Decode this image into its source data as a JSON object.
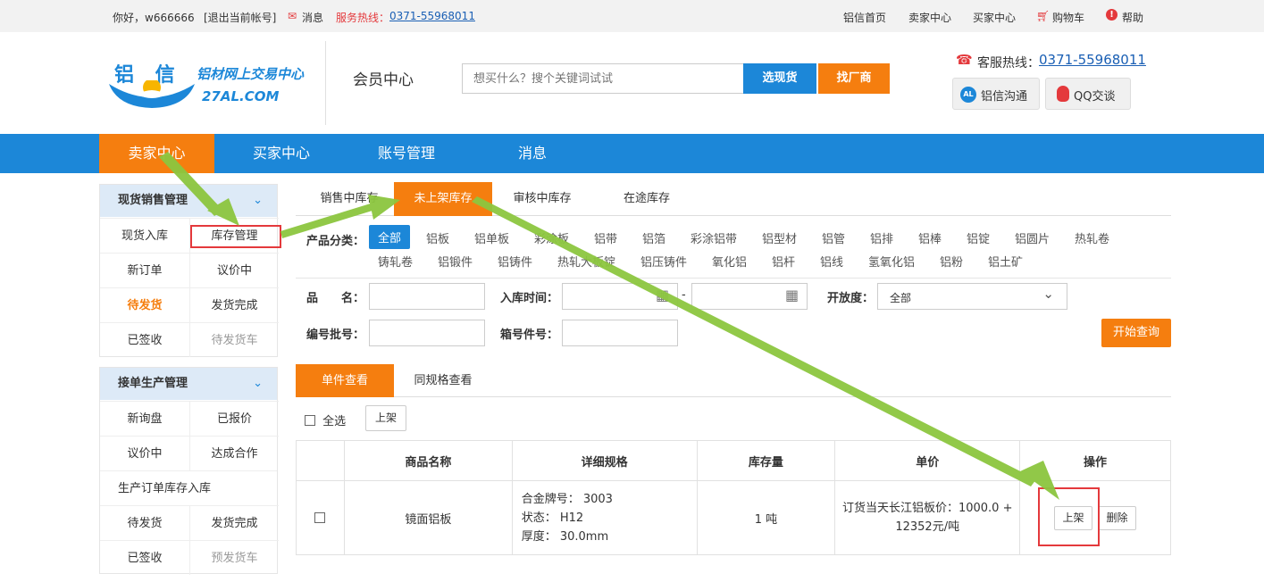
{
  "topbar": {
    "greeting": "你好，w666666",
    "logout": "[退出当前帐号]",
    "message": "消息",
    "hotline_label": "服务热线：",
    "hotline_number": "0371-55968011",
    "links": [
      "铝信首页",
      "卖家中心",
      "买家中心",
      "购物车",
      "帮助"
    ]
  },
  "header": {
    "logo_chars": "铝 信",
    "logo_slogan": "铝材网上交易中心",
    "logo_domain": "27AL.COM",
    "member_center": "会员中心",
    "search_placeholder": "想买什么？搜个关键词试试",
    "search_goods_button": "选现货",
    "search_factory_button": "找厂商",
    "service_label": "客服热线：",
    "service_number": "0371-55968011",
    "chat_button": "铝信沟通",
    "chat_badge": "AL",
    "qq_button": "QQ交谈"
  },
  "nav": {
    "items": [
      "卖家中心",
      "买家中心",
      "账号管理",
      "消息"
    ]
  },
  "sidebar": {
    "section1_title": "现货销售管理",
    "section1_items": [
      "现货入库",
      "库存管理",
      "新订单",
      "议价中",
      "待发货",
      "发货完成",
      "已签收",
      "待发货车"
    ],
    "section2_title": "接单生产管理",
    "section2_items": [
      "新询盘",
      "已报价",
      "议价中",
      "达成合作",
      "生产订单库存入库",
      "待发货",
      "发货完成",
      "已签收",
      "预发货车"
    ]
  },
  "tabs": [
    "销售中库存",
    "未上架库存",
    "审核中库存",
    "在途库存"
  ],
  "category": {
    "label": "产品分类：",
    "items": [
      "全部",
      "铝板",
      "铝单板",
      "彩涂板",
      "铝带",
      "铝箔",
      "彩涂铝带",
      "铝型材",
      "铝管",
      "铝排",
      "铝棒",
      "铝锭",
      "铝圆片",
      "热轧卷",
      "铸轧卷",
      "铝锻件",
      "铝铸件",
      "热轧大板锭",
      "铝压铸件",
      "氧化铝",
      "铝杆",
      "铝线",
      "氢氧化铝",
      "铝粉",
      "铝土矿"
    ]
  },
  "filters": {
    "name_label": "品　　名：",
    "date_label": "入库时间：",
    "date_sep": "-",
    "open_label": "开放度：",
    "open_value": "全部",
    "code_label": "编号批号：",
    "box_label": "箱号件号：",
    "query_button": "开始查询"
  },
  "subtabs": [
    "单件查看",
    "同规格查看"
  ],
  "actions": {
    "select_all": "全选",
    "shelve_button": "上架"
  },
  "table": {
    "headers": [
      "",
      "商品名称",
      "详细规格",
      "库存量",
      "单价",
      "操作"
    ],
    "rows": [
      {
        "name": "镜面铝板",
        "spec": [
          "合金牌号：  3003",
          "状态：  H12",
          "厚度：  30.0mm"
        ],
        "stock": "1 吨",
        "price": [
          "订货当天长江铝板价：1000.0 +",
          "12352元/吨"
        ],
        "op_shelve": "上架",
        "op_delete": "删除"
      }
    ]
  },
  "colors": {
    "orange": "#f57e0f",
    "blue": "#1c87d8",
    "annotation_green": "#8cc63f",
    "annotation_red": "#e4393c"
  }
}
